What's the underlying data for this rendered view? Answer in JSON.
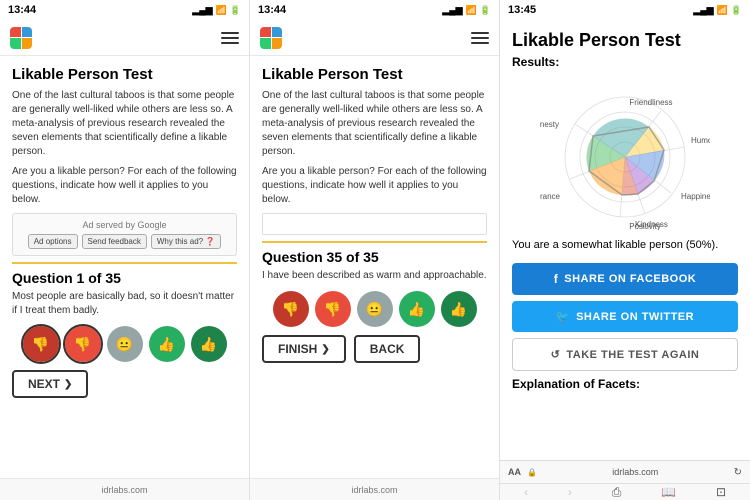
{
  "panel1": {
    "time": "13:44",
    "title": "Likable Person Test",
    "description1": "One of the last cultural taboos is that some people are generally well-liked while others are less so. A meta-analysis of previous research revealed the seven elements that scientifically define a likable person.",
    "description2": "Are you a likable person? For each of the following questions, indicate how well it applies to you below.",
    "ad_text": "Ad served by Google",
    "ad_btn1": "Ad options",
    "ad_btn2": "Send feedback",
    "ad_btn3": "Why this ad? ❓",
    "question_header": "Question 1 of 35",
    "question_text": "Most people are basically bad, so it doesn't matter if I treat them badly.",
    "next_label": "NEXT",
    "bottom": "idrlabs.com"
  },
  "panel2": {
    "time": "13:44",
    "title": "Likable Person Test",
    "description1": "One of the last cultural taboos is that some people are generally well-liked while others are less so. A meta-analysis of previous research revealed the seven elements that scientifically define a likable person.",
    "description2": "Are you a likable person? For each of the following questions, indicate how well it applies to you below.",
    "question_header": "Question 35 of 35",
    "question_text": "I have been described as warm and approachable.",
    "finish_label": "FINISH",
    "back_label": "BACK",
    "bottom": "idrlabs.com"
  },
  "panel3": {
    "time": "13:45",
    "title": "Likable Person Test",
    "results_label": "Results:",
    "result_text": "You are a somewhat likable person (50%).",
    "share_facebook": "SHARE ON FACEBOOK",
    "share_twitter": "SHARE ON TWITTER",
    "retake": "TAKE THE TEST AGAIN",
    "explanation": "Explanation of Facets:",
    "url_font": "AA",
    "url_domain": "idrlabs.com",
    "radar": {
      "labels": [
        "Friendliness",
        "Humor",
        "Happiness",
        "Kindness",
        "Positivity",
        "Tolerance",
        "Honesty"
      ],
      "values": [
        0.65,
        0.55,
        0.6,
        0.5,
        0.7,
        0.45,
        0.55
      ]
    },
    "nav_back": "‹",
    "nav_forward": "›",
    "nav_share": "⎙",
    "nav_book": "⊟",
    "nav_tab": "↗"
  },
  "icons": {
    "thumbs_down_dark": "👎",
    "thumbs_down": "👎",
    "neutral": "😐",
    "thumbs_up": "👍",
    "thumbs_up_dark": "👍",
    "facebook_icon": "f",
    "twitter_icon": "𝕥",
    "retake_icon": "↺",
    "arrow_right": "❯",
    "signal": "▂▄▆",
    "wifi": "📶",
    "battery": "🔋"
  }
}
